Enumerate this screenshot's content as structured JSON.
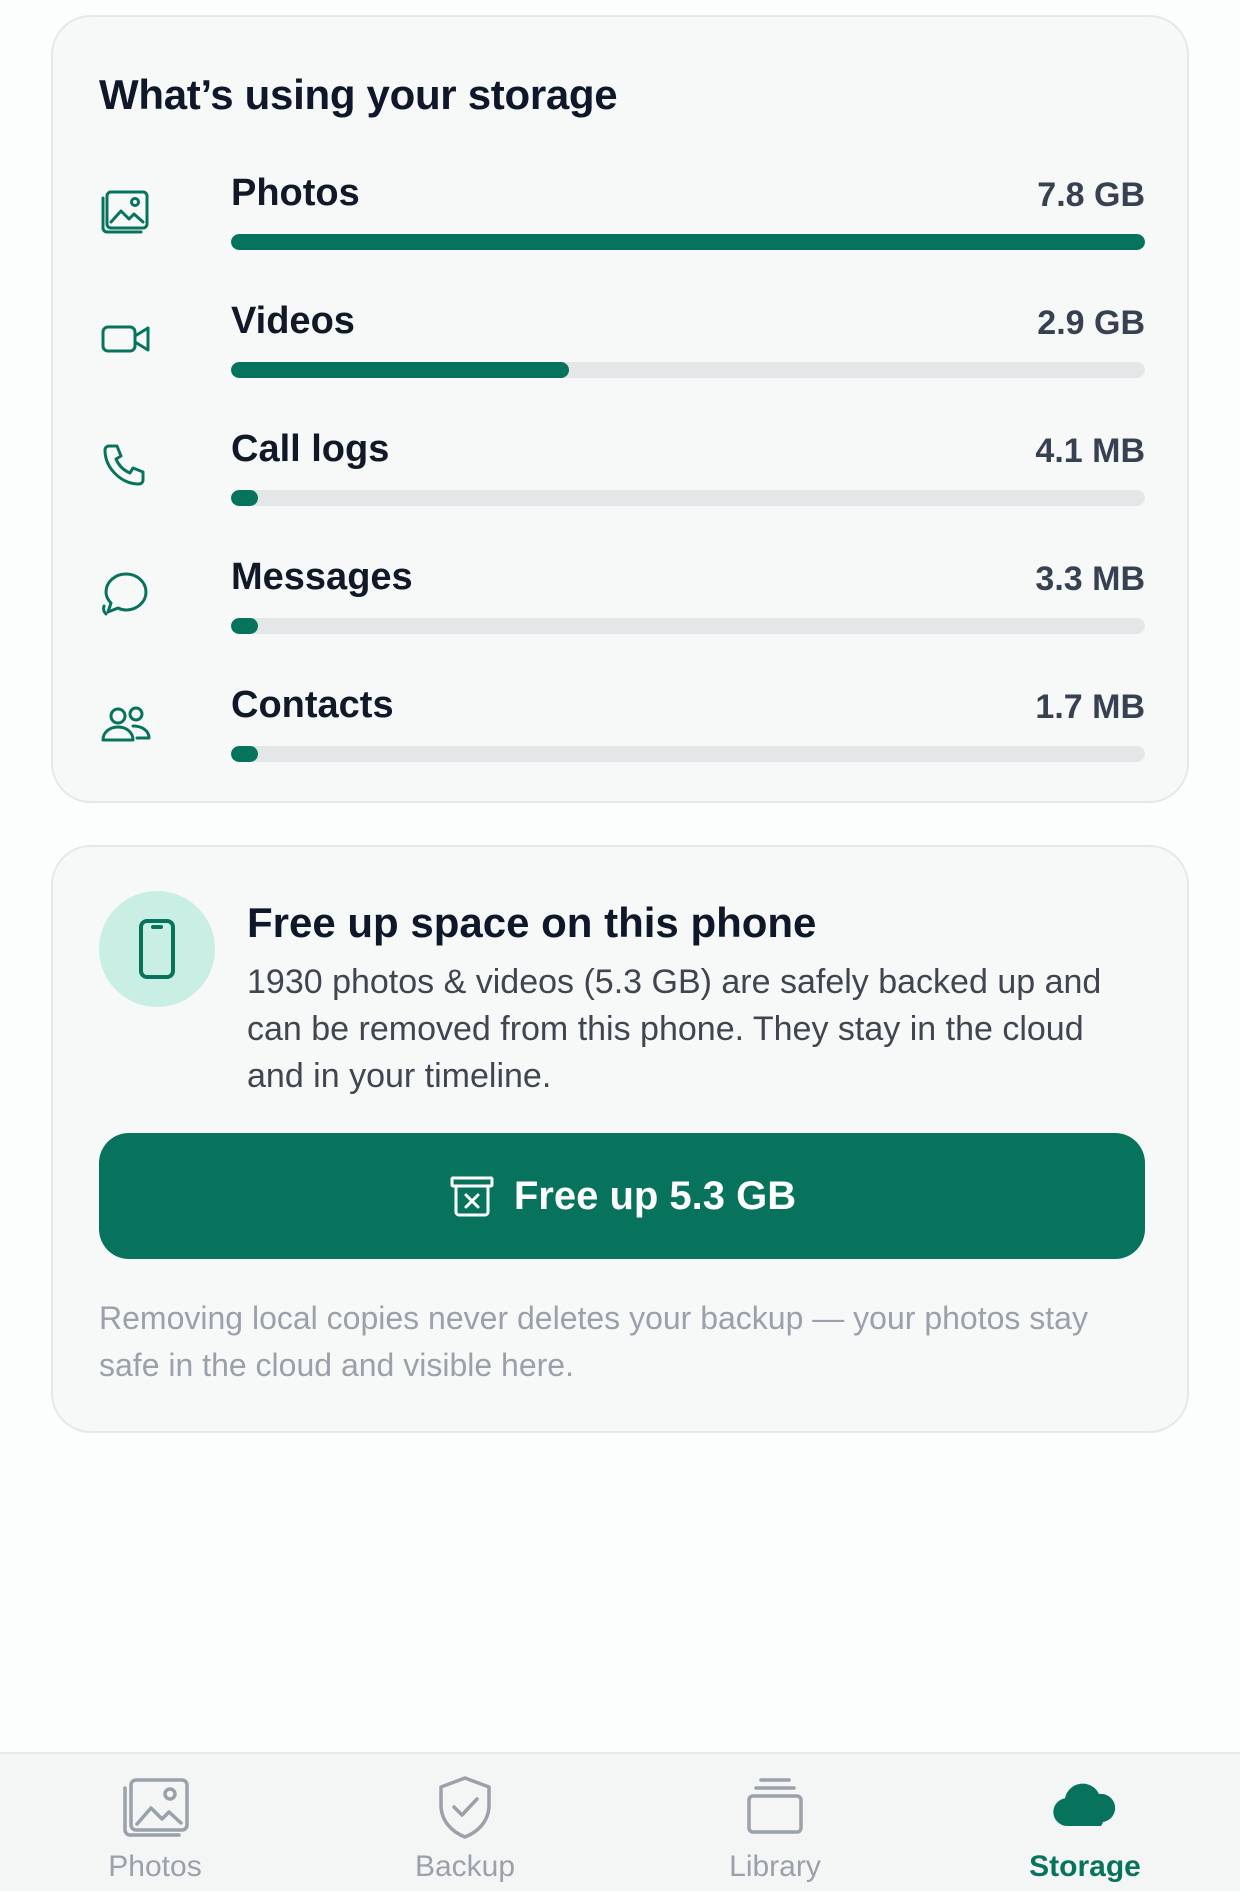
{
  "usage": {
    "title": "What’s using your storage",
    "items": [
      {
        "label": "Photos",
        "size": "7.8 GB",
        "fraction": 1.0,
        "icon": "image-icon"
      },
      {
        "label": "Videos",
        "size": "2.9 GB",
        "fraction": 0.37,
        "icon": "video-icon"
      },
      {
        "label": "Call logs",
        "size": "4.1 MB",
        "fraction": 0.03,
        "icon": "phone-icon"
      },
      {
        "label": "Messages",
        "size": "3.3 MB",
        "fraction": 0.03,
        "icon": "chat-bubble-icon"
      },
      {
        "label": "Contacts",
        "size": "1.7 MB",
        "fraction": 0.03,
        "icon": "contacts-icon"
      }
    ]
  },
  "free_up": {
    "title": "Free up space on this phone",
    "description": "1930 photos & videos (5.3 GB) are safely backed up and can be removed from this phone. They stay in the cloud and in your timeline.",
    "button_label": "Free up 5.3 GB",
    "note": "Removing local copies never deletes your backup — your photos stay safe in the cloud and visible here."
  },
  "nav": {
    "items": [
      {
        "label": "Photos",
        "icon": "photos-icon",
        "active": false
      },
      {
        "label": "Backup",
        "icon": "shield-check-icon",
        "active": false
      },
      {
        "label": "Library",
        "icon": "library-icon",
        "active": false
      },
      {
        "label": "Storage",
        "icon": "cloud-icon",
        "active": true
      }
    ]
  },
  "colors": {
    "accent": "#08735d",
    "accent_light": "#c9eee3",
    "track": "#e3e7e7"
  }
}
